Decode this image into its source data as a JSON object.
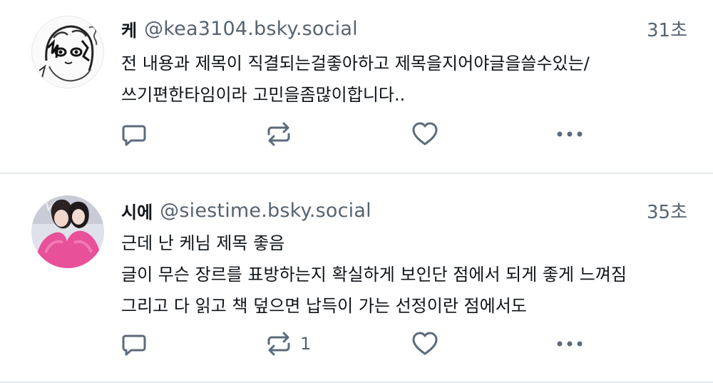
{
  "posts": [
    {
      "display_name": "케",
      "handle": "@kea3104.bsky.social",
      "time": "31초",
      "text_lines": [
        "전 내용과 제목이 직결되는걸좋아하고 제목을지어야글을쓸수있는/",
        "쓰기편한타임이라 고민을좀많이합니다.."
      ],
      "actions": {
        "reply": "reply-icon",
        "repost": "repost-icon",
        "like": "heart-icon",
        "more": "more-icon",
        "repost_count": ""
      }
    },
    {
      "display_name": "시에",
      "handle": "@siestime.bsky.social",
      "time": "35초",
      "text_lines": [
        "근데 난 케님 제목 좋음",
        "글이 무슨 장르를 표방하는지 확실하게 보인단 점에서 되게 좋게 느껴짐",
        "그리고 다 읽고 책 덮으면 납득이 가는 선정이란 점에서도"
      ],
      "actions": {
        "reply": "reply-icon",
        "repost": "repost-icon",
        "like": "heart-icon",
        "more": "more-icon",
        "repost_count": "1"
      }
    }
  ],
  "colors": {
    "text": "#0f1419",
    "muted": "#56636f",
    "icon": "#5b6b7c",
    "divider": "#e3e7eb",
    "avatar_pink": "#e8509a"
  }
}
